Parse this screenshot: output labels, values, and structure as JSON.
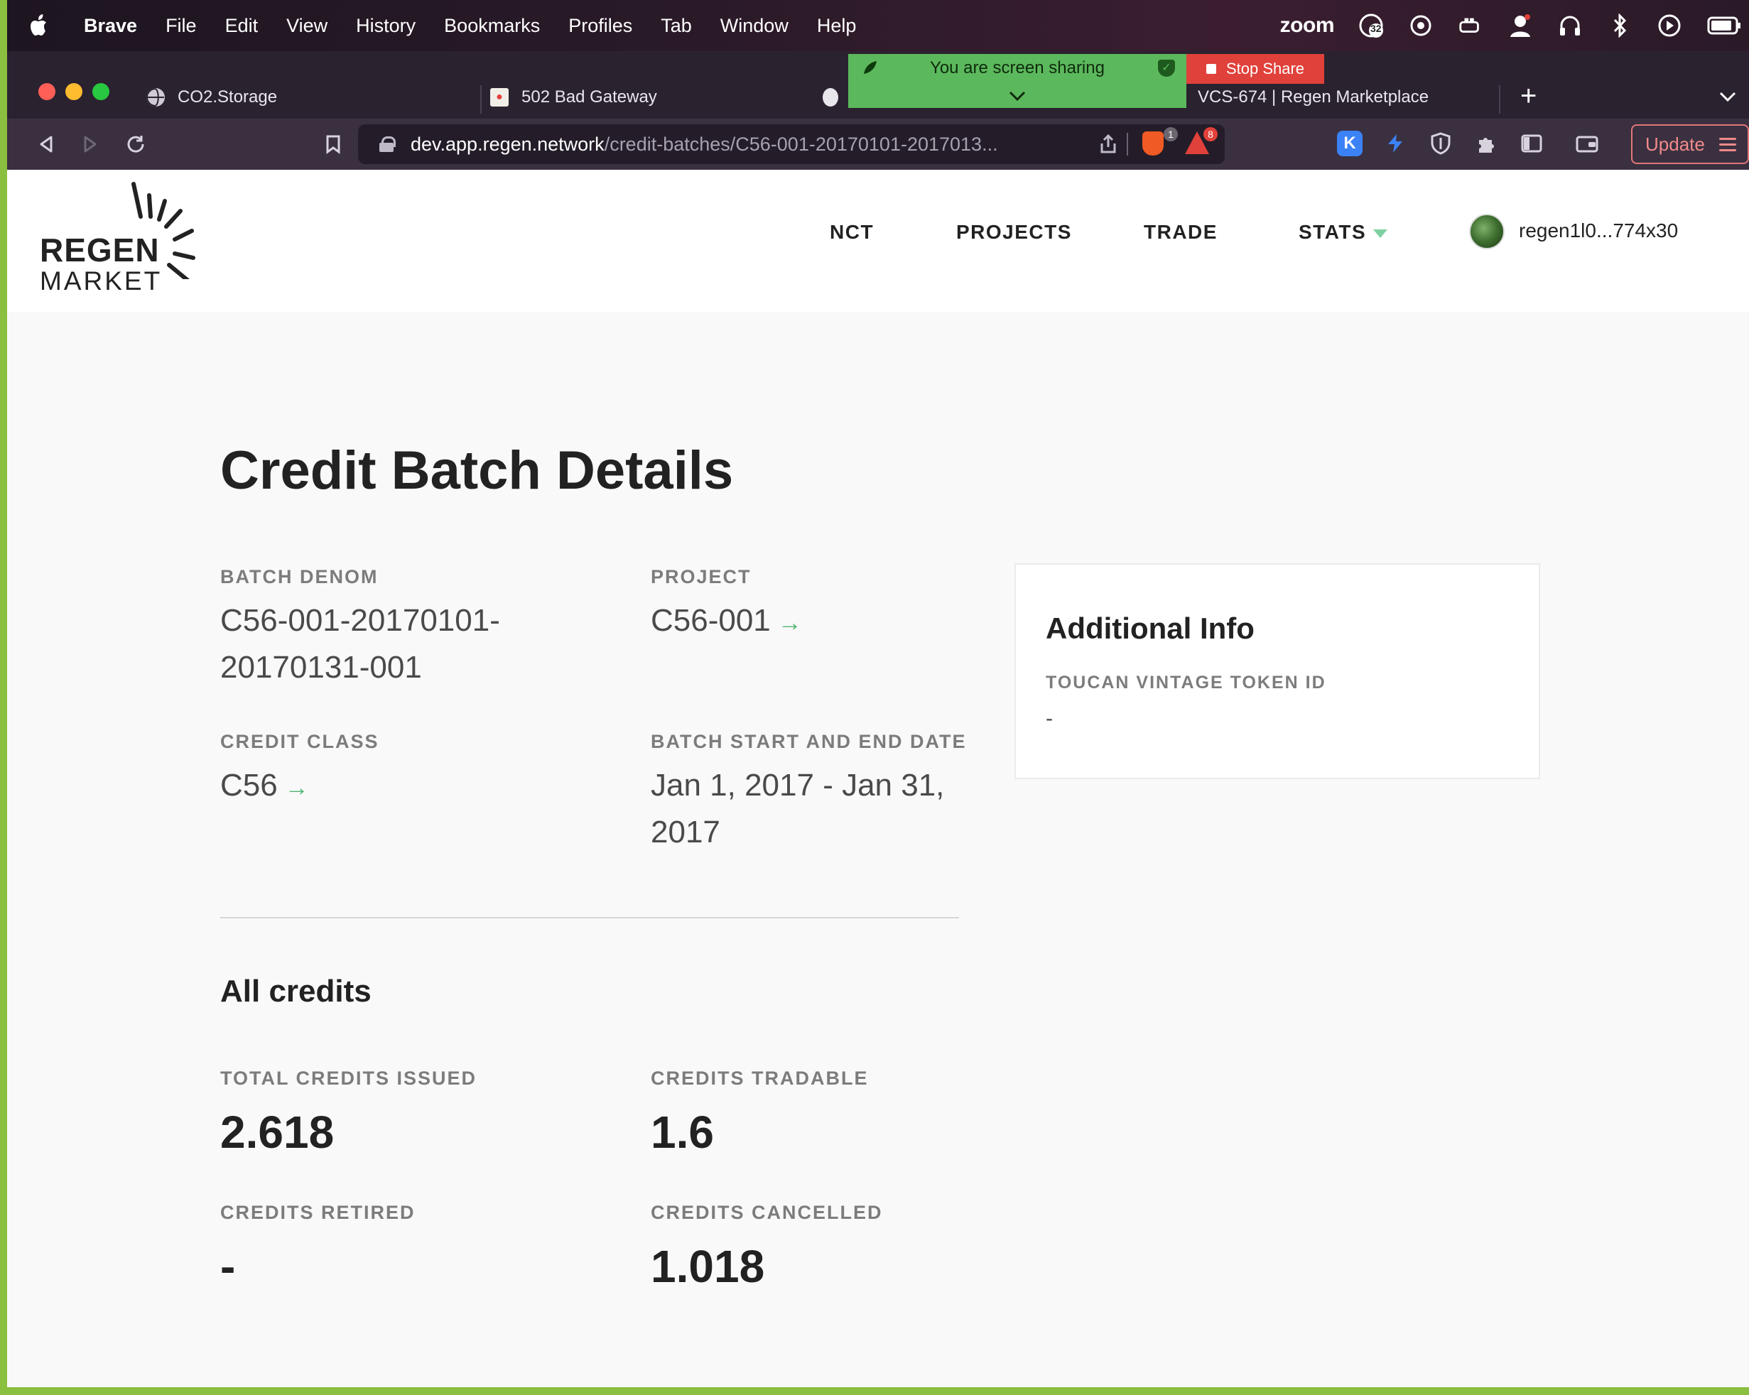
{
  "menubar": {
    "app": "Brave",
    "items": [
      "File",
      "Edit",
      "View",
      "History",
      "Bookmarks",
      "Profiles",
      "Tab",
      "Window",
      "Help"
    ],
    "zoom": "zoom",
    "notification_count": "32"
  },
  "tabs": [
    {
      "label": "CO2.Storage"
    },
    {
      "label": "502 Bad Gateway"
    },
    {
      "label": "VCS-674 | Regen Marketplace"
    }
  ],
  "share_banner": {
    "text": "You are screen sharing",
    "stop_label": "Stop Share"
  },
  "toolbar": {
    "url_host": "dev.app.regen.network",
    "url_path": "/credit-batches/C56-001-20170101-2017013...",
    "brave_badge": "1",
    "rewards_badge": "8",
    "update_label": "Update"
  },
  "site": {
    "logo_line1": "REGEN",
    "logo_line2": "MARKET",
    "nav": [
      "NCT",
      "PROJECTS",
      "TRADE",
      "STATS"
    ],
    "wallet": "regen1l0...774x30"
  },
  "main": {
    "title": "Credit Batch Details",
    "batch_denom_label": "BATCH DENOM",
    "batch_denom_line1": "C56-001-20170101-",
    "batch_denom_line2": "20170131-001",
    "project_label": "PROJECT",
    "project_value": "C56-001",
    "credit_class_label": "CREDIT CLASS",
    "credit_class_value": "C56",
    "dates_label": "BATCH START AND END DATE",
    "dates_line1": "Jan 1, 2017 - Jan 31,",
    "dates_line2": "2017",
    "all_credits": "All credits",
    "total_issued_label": "TOTAL CREDITS ISSUED",
    "total_issued": "2.618",
    "tradable_label": "CREDITS TRADABLE",
    "tradable": "1.6",
    "retired_label": "CREDITS RETIRED",
    "retired": "-",
    "cancelled_label": "CREDITS CANCELLED",
    "cancelled": "1.018"
  },
  "info_card": {
    "title": "Additional Info",
    "label": "TOUCAN VINTAGE TOKEN ID",
    "value": "-"
  },
  "colors": {
    "accent_green": "#4fb573",
    "stop_red": "#e0413a",
    "share_green": "#5cb85c"
  }
}
